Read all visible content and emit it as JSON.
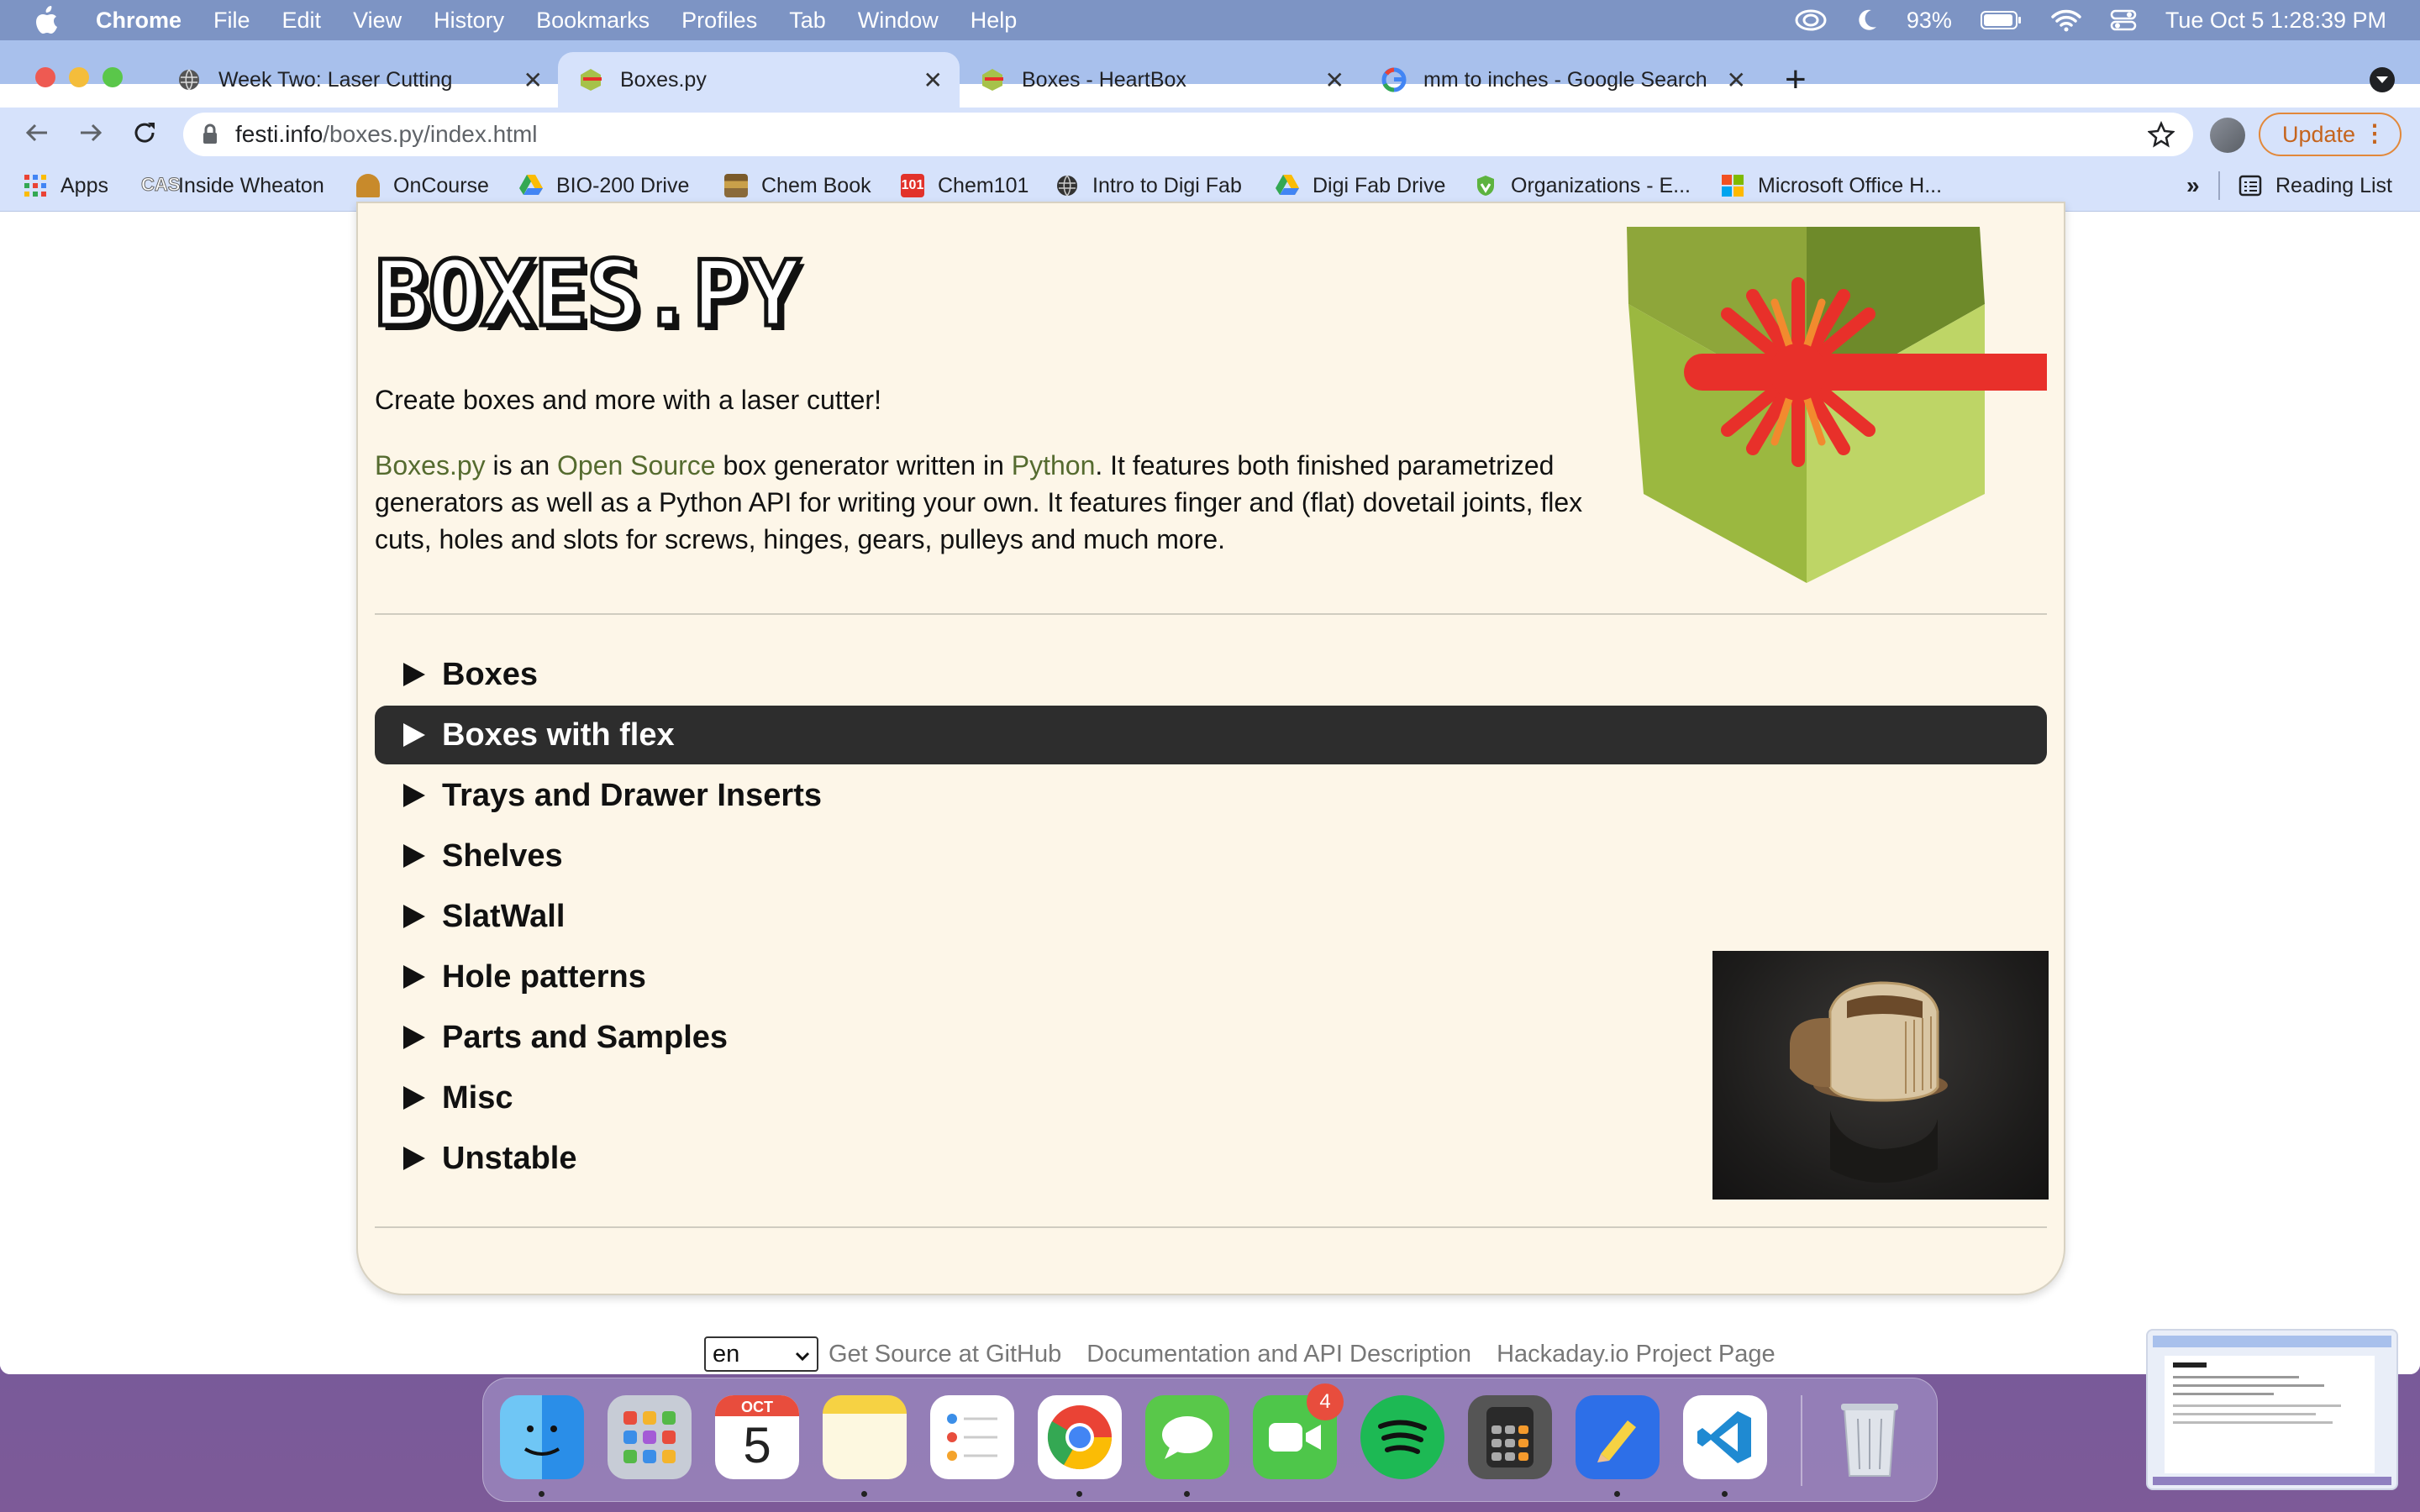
{
  "menubar": {
    "app_name": "Chrome",
    "items": [
      "File",
      "Edit",
      "View",
      "History",
      "Bookmarks",
      "Profiles",
      "Tab",
      "Window",
      "Help"
    ],
    "battery": "93%",
    "datetime": "Tue Oct 5  1:28:39 PM"
  },
  "tabs": [
    {
      "title": "Week Two: Laser Cutting",
      "favicon": "globe-icon"
    },
    {
      "title": "Boxes.py",
      "favicon": "boxes-icon"
    },
    {
      "title": "Boxes - HeartBox",
      "favicon": "boxes-icon"
    },
    {
      "title": "mm to inches - Google Search",
      "favicon": "google-icon"
    }
  ],
  "toolbar": {
    "url_domain": "festi.info",
    "url_path": "/boxes.py/index.html",
    "update_label": "Update"
  },
  "bookmarks": [
    {
      "label": "Apps",
      "icon": "apps-grid-icon"
    },
    {
      "label": "Inside Wheaton",
      "icon": "cas-icon"
    },
    {
      "label": "OnCourse",
      "icon": "oncourse-icon"
    },
    {
      "label": "BIO-200 Drive",
      "icon": "drive-icon"
    },
    {
      "label": "Chem Book",
      "icon": "book-icon"
    },
    {
      "label": "Chem101",
      "icon": "chem101-icon"
    },
    {
      "label": "Intro to Digi Fab",
      "icon": "globe-icon"
    },
    {
      "label": "Digi Fab Drive",
      "icon": "drive-icon"
    },
    {
      "label": "Organizations - E...",
      "icon": "organizations-icon"
    },
    {
      "label": "Microsoft Office H...",
      "icon": "office-icon"
    }
  ],
  "bookmarks_more": "»",
  "reading_list": "Reading List",
  "page": {
    "logo_text": "BOXES.PY",
    "intro": "Create boxes and more with a laser cutter!",
    "desc_link1": "Boxes.py",
    "desc_t1": " is an ",
    "desc_link2": "Open Source",
    "desc_t2": " box generator written in ",
    "desc_link3": "Python",
    "desc_t3": ". It features both finished parametrized generators as well as a Python API for writing your own. It features finger and (flat) dovetail joints, flex cuts, holes and slots for screws, hinges, gears, pulleys and much more.",
    "categories": [
      "Boxes",
      "Boxes with flex",
      "Trays and Drawer Inserts",
      "Shelves",
      "SlatWall",
      "Hole patterns",
      "Parts and Samples",
      "Misc",
      "Unstable"
    ]
  },
  "footer": {
    "lang_value": "en",
    "links": [
      "Get Source at GitHub",
      "Documentation and API Description",
      "Hackaday.io Project Page"
    ]
  },
  "dock": {
    "calendar_month": "OCT",
    "calendar_day": "5",
    "facetime_badge": "4"
  },
  "colors": {
    "accent_link": "#556b2f",
    "page_bg": "#fdf6e8",
    "hover_row": "#2d2d2d",
    "laser_red": "#e8302a",
    "hex_green": "#a6c24a"
  }
}
